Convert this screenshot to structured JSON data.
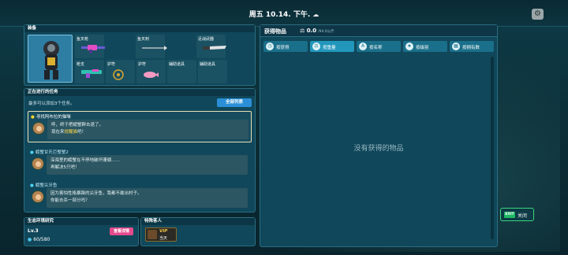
{
  "topbar": {
    "date": "周五 10.14. 下午.",
    "weather_icon": "cloud-icon"
  },
  "equipment": {
    "title": "装备",
    "slots": [
      {
        "label": "鱼叉枪"
      },
      {
        "label": "鱼叉刺"
      },
      {
        "label": "近战武器"
      },
      {
        "label": "枪支"
      },
      {
        "label": "护符"
      },
      {
        "label": "护符"
      },
      {
        "label": "辅助道具"
      },
      {
        "label": "辅助道具"
      }
    ]
  },
  "quests": {
    "title": "正在进行的任务",
    "note": "最多可以添加3个任务。",
    "list_button": "全部列表",
    "items": [
      {
        "title": "寻找阿布拉的猫咪",
        "line1": "呼，终于把螃蟹群击退了。",
        "line2_a": "现在来",
        "line2_hl": "提醒猫",
        "line2_b": "吧！"
      },
      {
        "title": "螃蟹甘氏巨蟹蟹2",
        "line1": "深海里的螃蟹在不停地破坏珊瑚……",
        "line2_a": "再解决5只吧！",
        "line2_hl": "",
        "line2_b": ""
      },
      {
        "title": "螃蟹尖牙鱼",
        "line1": "因为害怕性格暴躁的尖牙鱼，我都不敢出村子。",
        "line2_a": "你能去杀一部分吗？",
        "line2_hl": "",
        "line2_b": ""
      }
    ]
  },
  "eco": {
    "title": "生态环境研究",
    "level": "Lv.3",
    "exp": "60/580",
    "detail_button": "查看详情"
  },
  "guest": {
    "title": "特殊客人",
    "vip": "VIP",
    "day": "当天"
  },
  "obtained": {
    "title": "获得物品",
    "coin_value": "0.0",
    "coin_unit": "/94.0公斤",
    "tabs": [
      {
        "label": "按获得",
        "icon": "clock-icon"
      },
      {
        "label": "按重量",
        "icon": "weight-icon"
      },
      {
        "label": "按名称",
        "icon": "name-icon"
      },
      {
        "label": "按级别",
        "icon": "star-icon"
      },
      {
        "label": "按拥有数",
        "icon": "count-icon"
      }
    ],
    "empty_text": "没有获得的物品"
  },
  "close_button": {
    "icon_text": "EXIT",
    "label": "关闭"
  }
}
